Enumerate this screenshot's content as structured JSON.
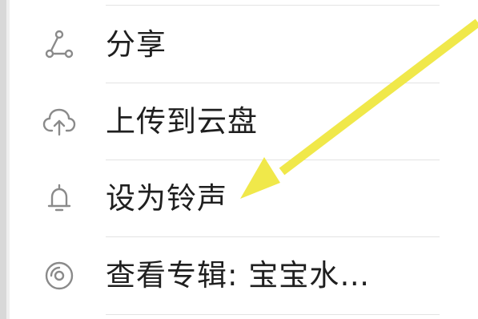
{
  "menu": {
    "items": [
      {
        "label": "分享",
        "icon": "share-icon"
      },
      {
        "label": "上传到云盘",
        "icon": "cloud-upload-icon"
      },
      {
        "label": "设为铃声",
        "icon": "bell-icon"
      },
      {
        "label": "查看专辑: 宝宝水…",
        "icon": "album-disc-icon"
      }
    ]
  },
  "annotation": {
    "arrow_color": "#f0e84a",
    "points_to": "设为铃声"
  }
}
